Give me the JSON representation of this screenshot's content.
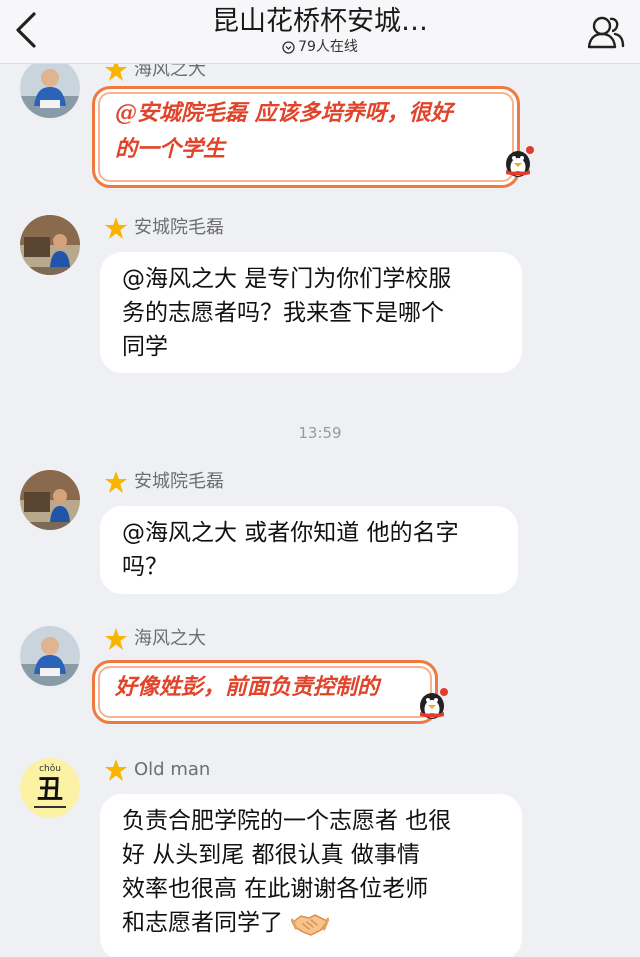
{
  "header": {
    "title": "昆山花桥杯安城…",
    "online": "79人在线",
    "back_icon": "chevron-left-icon",
    "members_icon": "group-members-icon"
  },
  "timestamp": "13:59",
  "colors": {
    "pretty_border": "#f0793f",
    "pretty_text": "#e0452b",
    "star": "#f7b500",
    "background": "#eef0f4"
  },
  "messages": [
    {
      "sender": "海风之大",
      "lines": [
        "@安城院毛磊 应该多培养呀，很好",
        "的一个学生"
      ],
      "style": "pretty"
    },
    {
      "sender": "安城院毛磊",
      "lines": [
        "@海风之大 是专门为你们学校服",
        "务的志愿者吗？我来查下是哪个",
        "同学"
      ],
      "style": "plain"
    },
    {
      "sender": "安城院毛磊",
      "lines": [
        "@海风之大 或者你知道 他的名字",
        "吗？"
      ],
      "style": "plain"
    },
    {
      "sender": "海风之大",
      "lines": [
        "好像姓彭，前面负责控制的"
      ],
      "style": "pretty"
    },
    {
      "sender": "Old  man",
      "lines": [
        "负责合肥学院的一个志愿者  也很",
        "好   从头到尾    都很认真  做事情",
        "效率也很高      在此谢谢各位老师",
        "和志愿者同学了"
      ],
      "style": "plain",
      "emoji": "handshake-emoji"
    }
  ],
  "avatars": {
    "oldman_pinyin": "chǒu",
    "oldman_char": "丑"
  }
}
